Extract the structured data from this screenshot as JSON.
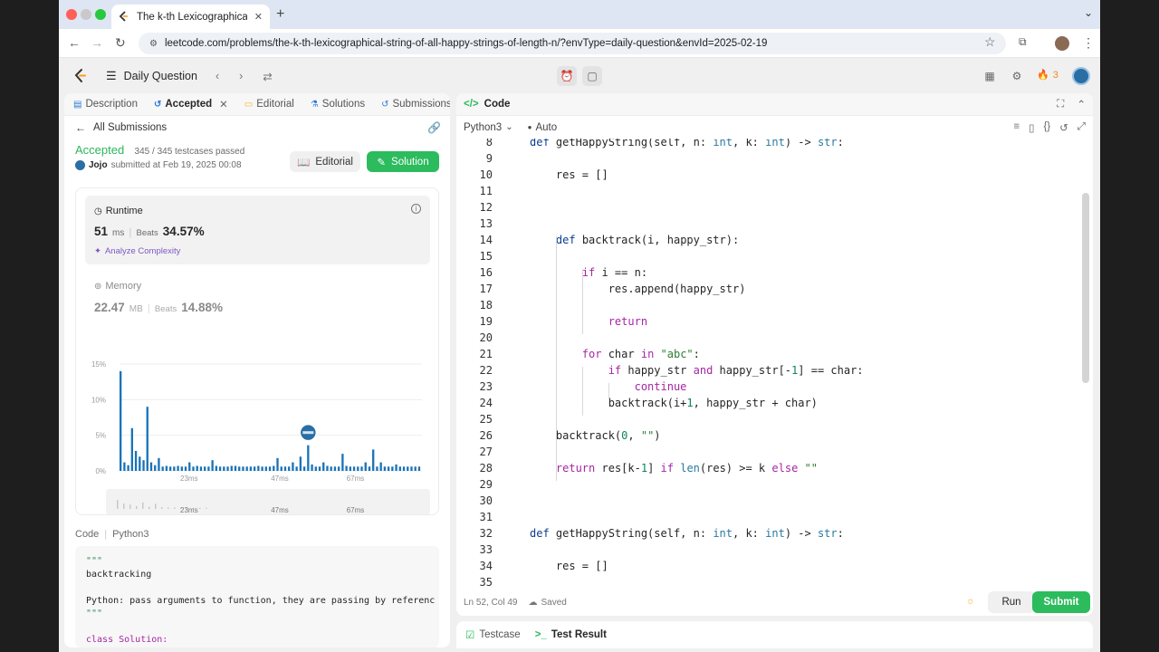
{
  "browser": {
    "tab_title": "The k-th Lexicographical Strin",
    "url": "leetcode.com/problems/the-k-th-lexicographical-string-of-all-happy-strings-of-length-n/?envType=daily-question&envId=2025-02-19"
  },
  "nav": {
    "daily_label": "Daily Question",
    "streak_count": "3"
  },
  "left_tabs": [
    {
      "label": "Description"
    },
    {
      "label": "Accepted"
    },
    {
      "label": "Editorial"
    },
    {
      "label": "Solutions"
    },
    {
      "label": "Submissions"
    }
  ],
  "submission": {
    "back_label": "All Submissions",
    "status": "Accepted",
    "testcases": "345 / 345 testcases passed",
    "user": "Jojo",
    "submitted": "submitted at Feb 19, 2025 00:08",
    "editorial_btn": "Editorial",
    "solution_btn": "Solution"
  },
  "runtime": {
    "label": "Runtime",
    "value": "51",
    "unit": "ms",
    "beats_label": "Beats",
    "beats": "34.57%",
    "analyze": "Analyze Complexity"
  },
  "memory": {
    "label": "Memory",
    "value": "22.47",
    "unit": "MB",
    "beats_label": "Beats",
    "beats": "14.88%"
  },
  "chart_data": {
    "type": "bar",
    "title": "",
    "xlabel": "",
    "ylabel": "",
    "ylim": [
      0,
      15
    ],
    "y_ticks": [
      "15%",
      "10%",
      "5%",
      "0%"
    ],
    "x_ticks": [
      "23ms",
      "47ms",
      "67ms"
    ],
    "mini_x_ticks": [
      "23ms",
      "47ms",
      "67ms"
    ],
    "values": [
      14,
      1.2,
      0.8,
      6,
      2.8,
      2,
      1.5,
      9,
      1.2,
      0.8,
      1.8,
      0.6,
      0.7,
      0.6,
      0.6,
      0.7,
      0.6,
      0.6,
      1.2,
      0.6,
      0.7,
      0.6,
      0.6,
      0.6,
      1.5,
      0.7,
      0.6,
      0.6,
      0.6,
      0.7,
      0.7,
      0.6,
      0.6,
      0.6,
      0.6,
      0.6,
      0.7,
      0.6,
      0.6,
      0.6,
      0.7,
      1.8,
      0.6,
      0.6,
      0.6,
      1.2,
      0.6,
      2,
      0.6,
      3.6,
      0.9,
      0.6,
      0.6,
      1.2,
      0.7,
      0.6,
      0.6,
      0.6,
      2.4,
      0.7,
      0.6,
      0.6,
      0.6,
      0.6,
      1.2,
      0.6,
      3,
      0.6,
      1.2,
      0.6,
      0.6,
      0.6,
      0.9,
      0.6,
      0.6,
      0.6,
      0.6,
      0.6,
      0.6
    ],
    "highlight_index": 49,
    "bar_color": "#1a73b8",
    "mini_values": [
      2.5,
      1.5,
      1.2,
      0.8,
      1.8,
      0.6,
      1.4,
      0.5,
      0.4,
      0.4,
      0.3,
      0.3,
      0.3,
      0.3,
      0.3
    ]
  },
  "code_preview": {
    "header_code": "Code",
    "header_lang": "Python3",
    "lines": [
      {
        "cls": "str",
        "text": "\"\"\""
      },
      {
        "cls": "",
        "text": "backtracking"
      },
      {
        "cls": "",
        "text": ""
      },
      {
        "cls": "",
        "text": "Python: pass arguments to function, they are passing by referenc"
      },
      {
        "cls": "str",
        "text": "\"\"\""
      },
      {
        "cls": "",
        "text": ""
      },
      {
        "cls": "kw",
        "text": "class Solution:"
      }
    ]
  },
  "editor": {
    "panel_title": "Code",
    "language": "Python3",
    "mode": "Auto",
    "cursor": "Ln 52, Col 49",
    "saved": "Saved",
    "run": "Run",
    "submit": "Submit",
    "lines": [
      {
        "n": "8",
        "html": "<span class=\"kwb\">def</span> getHappyString(self, n: <span class=\"ty\">int</span>, k: <span class=\"ty\">int</span>) -&gt; <span class=\"ty\">str</span>:"
      },
      {
        "n": "9",
        "html": ""
      },
      {
        "n": "10",
        "html": "    res = []"
      },
      {
        "n": "11",
        "html": ""
      },
      {
        "n": "12",
        "html": ""
      },
      {
        "n": "13",
        "html": ""
      },
      {
        "n": "14",
        "html": "    <span class=\"kwb\">def</span> backtrack(i, happy_str):"
      },
      {
        "n": "15",
        "html": ""
      },
      {
        "n": "16",
        "html": "        <span class=\"kw\">if</span> i == n:"
      },
      {
        "n": "17",
        "html": "            res.append(happy_str)"
      },
      {
        "n": "18",
        "html": ""
      },
      {
        "n": "19",
        "html": "            <span class=\"kw\">return</span>"
      },
      {
        "n": "20",
        "html": ""
      },
      {
        "n": "21",
        "html": "        <span class=\"kw\">for</span> char <span class=\"kw\">in</span> <span class=\"st\">\"abc\"</span>:"
      },
      {
        "n": "22",
        "html": "            <span class=\"kw\">if</span> happy_str <span class=\"kw\">and</span> happy_str[-<span class=\"nm\">1</span>] == char:"
      },
      {
        "n": "23",
        "html": "                <span class=\"kw\">continue</span>"
      },
      {
        "n": "24",
        "html": "            backtrack(i+<span class=\"nm\">1</span>, happy_str + char)"
      },
      {
        "n": "25",
        "html": ""
      },
      {
        "n": "26",
        "html": "    backtrack(<span class=\"nm\">0</span>, <span class=\"st\">\"\"</span>)"
      },
      {
        "n": "27",
        "html": ""
      },
      {
        "n": "28",
        "html": "    <span class=\"kw\">return</span> res[k-<span class=\"nm\">1</span>] <span class=\"kw\">if</span> <span class=\"ty\">len</span>(res) &gt;= k <span class=\"kw\">else</span> <span class=\"st\">\"\"</span>"
      },
      {
        "n": "29",
        "html": ""
      },
      {
        "n": "30",
        "html": ""
      },
      {
        "n": "31",
        "html": ""
      },
      {
        "n": "32",
        "html": "<span class=\"kwb\">def</span> getHappyString(self, n: <span class=\"ty\">int</span>, k: <span class=\"ty\">int</span>) -&gt; <span class=\"ty\">str</span>:"
      },
      {
        "n": "33",
        "html": ""
      },
      {
        "n": "34",
        "html": "    res = []"
      },
      {
        "n": "35",
        "html": ""
      }
    ]
  },
  "bottom_tabs": [
    {
      "label": "Testcase"
    },
    {
      "label": "Test Result"
    }
  ],
  "colors": {
    "accent_green": "#2cbb5d",
    "accepted_text": "#2db55d",
    "bar": "#1a73b8"
  }
}
